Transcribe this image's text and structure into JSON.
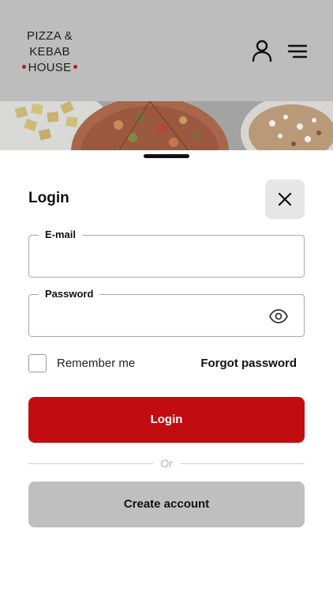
{
  "header": {
    "logo_line1": "PIZZA &",
    "logo_line2": "KEBAB",
    "logo_line3": "HOUSE",
    "icons": [
      "user-icon",
      "menu-icon"
    ]
  },
  "login_sheet": {
    "title": "Login",
    "close_icon": "close-icon",
    "email_label": "E-mail",
    "email_value": "",
    "password_label": "Password",
    "password_value": "",
    "password_toggle_icon": "eye-icon",
    "remember_label": "Remember me",
    "remember_checked": false,
    "forgot_label": "Forgot password",
    "login_label": "Login",
    "divider_label": "Or",
    "create_account_label": "Create account"
  },
  "colors": {
    "accent": "#c20d10",
    "logo_dot": "#c0121a",
    "overlay_gray": "#bdbdbd",
    "secondary_button": "#bfbfbf"
  }
}
